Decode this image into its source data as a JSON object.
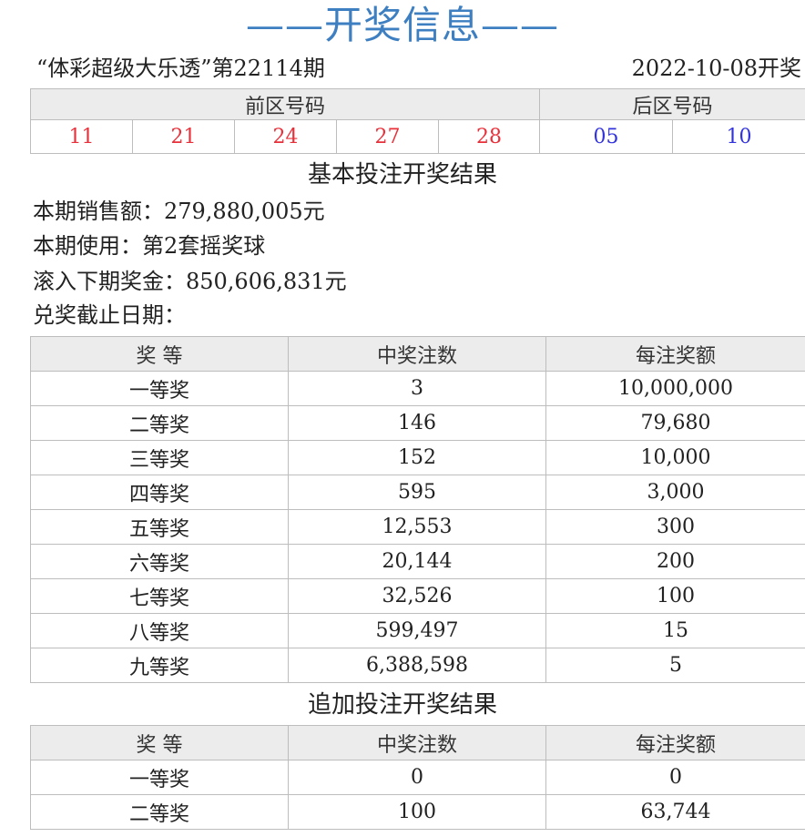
{
  "header": {
    "title": "——开奖信息——",
    "lottery_issue": "“体彩超级大乐透”第22114期",
    "draw_date": "2022-10-08开奖"
  },
  "numbers": {
    "front_label": "前区号码",
    "back_label": "后区号码",
    "front": [
      "11",
      "21",
      "24",
      "27",
      "28"
    ],
    "back": [
      "05",
      "10"
    ],
    "front_color": "#e8303a",
    "back_color": "#3333dd"
  },
  "basic": {
    "section_title": "基本投注开奖结果",
    "sales": "本期销售额：279,880,005元",
    "ball_set": "本期使用：第2套摇奖球",
    "rollover": "滚入下期奖金：850,606,831元",
    "deadline": "兑奖截止日期：",
    "columns": [
      "奖 等",
      "中奖注数",
      "每注奖额"
    ],
    "rows": [
      [
        "一等奖",
        "3",
        "10,000,000"
      ],
      [
        "二等奖",
        "146",
        "79,680"
      ],
      [
        "三等奖",
        "152",
        "10,000"
      ],
      [
        "四等奖",
        "595",
        "3,000"
      ],
      [
        "五等奖",
        "12,553",
        "300"
      ],
      [
        "六等奖",
        "20,144",
        "200"
      ],
      [
        "七等奖",
        "32,526",
        "100"
      ],
      [
        "八等奖",
        "599,497",
        "15"
      ],
      [
        "九等奖",
        "6,388,598",
        "5"
      ]
    ]
  },
  "extra": {
    "section_title": "追加投注开奖结果",
    "columns": [
      "奖 等",
      "中奖注数",
      "每注奖额"
    ],
    "rows": [
      [
        "一等奖",
        "0",
        "0"
      ],
      [
        "二等奖",
        "100",
        "63,744"
      ]
    ]
  }
}
